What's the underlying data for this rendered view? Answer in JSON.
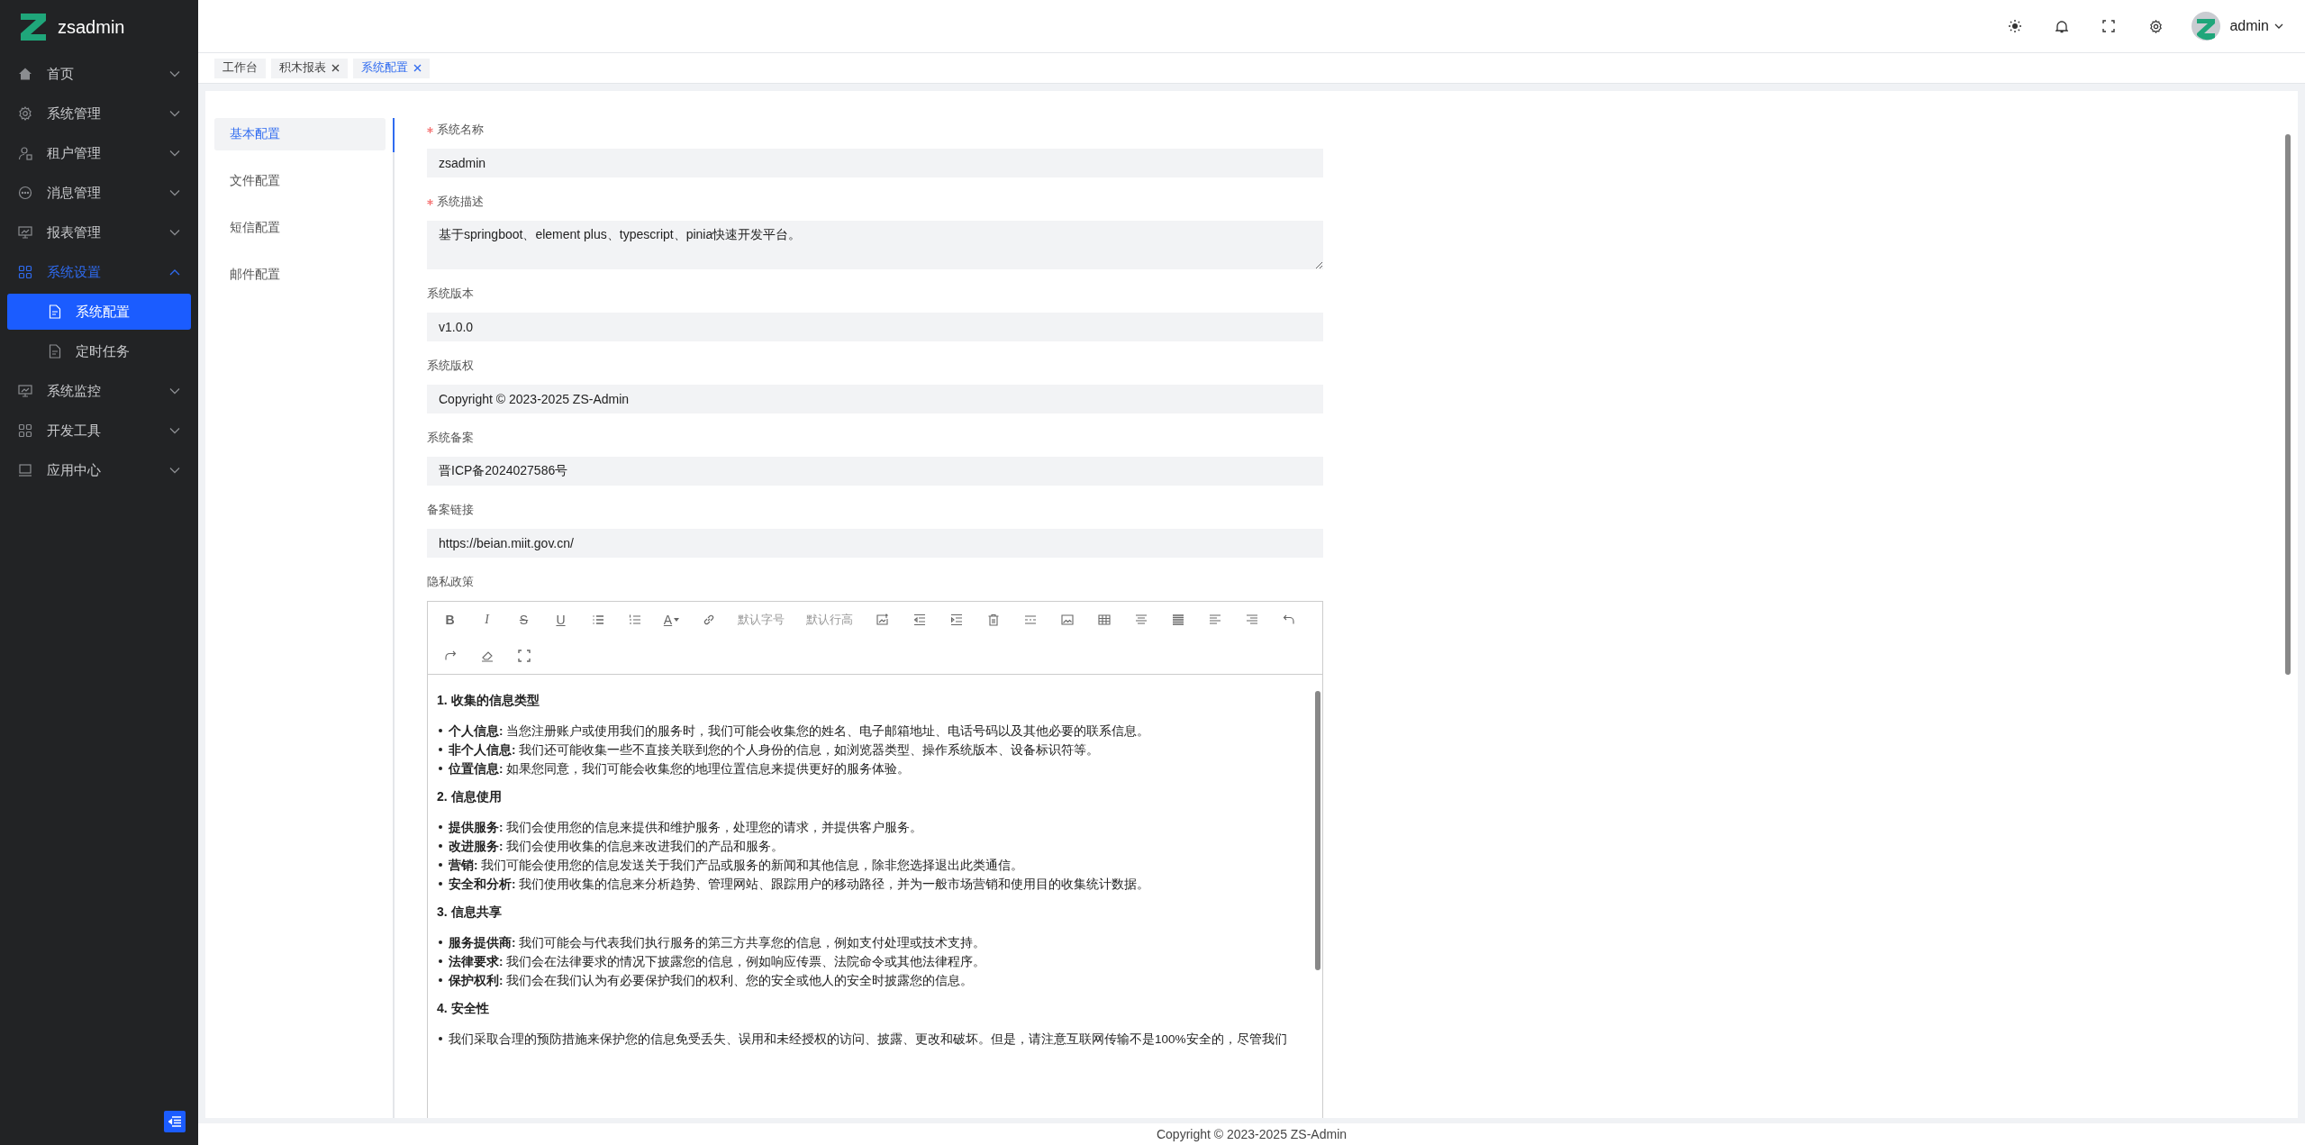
{
  "sidebar": {
    "logo": "zsadmin",
    "items": [
      {
        "kind": "home",
        "label": "首页",
        "expanded": false,
        "selected": false
      },
      {
        "kind": "gear",
        "label": "系统管理",
        "expanded": false,
        "selected": false
      },
      {
        "kind": "user",
        "label": "租户管理",
        "expanded": false,
        "selected": false
      },
      {
        "kind": "chat",
        "label": "消息管理",
        "expanded": false,
        "selected": false
      },
      {
        "kind": "board",
        "label": "报表管理",
        "expanded": false,
        "selected": false
      },
      {
        "kind": "grid",
        "label": "系统设置",
        "expanded": true,
        "selected": true,
        "children": [
          {
            "label": "系统配置",
            "selected": true
          },
          {
            "label": "定时任务",
            "selected": false
          }
        ]
      },
      {
        "kind": "board",
        "label": "系统监控",
        "expanded": false,
        "selected": false
      },
      {
        "kind": "grid",
        "label": "开发工具",
        "expanded": false,
        "selected": false
      },
      {
        "kind": "laptop",
        "label": "应用中心",
        "expanded": false,
        "selected": false
      }
    ]
  },
  "header": {
    "user": "admin"
  },
  "tabs": [
    {
      "label": "工作台",
      "closable": false,
      "selected": false
    },
    {
      "label": "积木报表",
      "closable": true,
      "selected": false
    },
    {
      "label": "系统配置",
      "closable": true,
      "selected": true
    }
  ],
  "config_tabs": [
    {
      "label": "基本配置",
      "selected": true
    },
    {
      "label": "文件配置",
      "selected": false
    },
    {
      "label": "短信配置",
      "selected": false
    },
    {
      "label": "邮件配置",
      "selected": false
    }
  ],
  "fields": [
    {
      "kind": "input",
      "label": "系统名称",
      "required": true,
      "value": "zsadmin"
    },
    {
      "kind": "textarea",
      "label": "系统描述",
      "required": true,
      "value": "基于springboot、element plus、typescript、pinia快速开发平台。"
    },
    {
      "kind": "input",
      "label": "系统版本",
      "required": false,
      "value": "v1.0.0"
    },
    {
      "kind": "input",
      "label": "系统版权",
      "required": false,
      "value": "Copyright © 2023-2025 ZS-Admin"
    },
    {
      "kind": "input",
      "label": "系统备案",
      "required": false,
      "value": "晋ICP备2024027586号"
    },
    {
      "kind": "input",
      "label": "备案链接",
      "required": false,
      "value": "https://beian.miit.gov.cn/"
    }
  ],
  "editor": {
    "label": "隐私政策",
    "toolbar": [
      {
        "kind": "bold",
        "label": "B"
      },
      {
        "kind": "italic",
        "label": "I"
      },
      {
        "kind": "strike",
        "label": "S"
      },
      {
        "kind": "underline",
        "label": "U"
      },
      {
        "kind": "bullets"
      },
      {
        "kind": "numbers"
      },
      {
        "kind": "color",
        "label": "A"
      },
      {
        "kind": "link"
      },
      {
        "kind": "select",
        "label": "默认字号"
      },
      {
        "kind": "select",
        "label": "默认行高"
      },
      {
        "kind": "image-upload"
      },
      {
        "kind": "outdent"
      },
      {
        "kind": "indent"
      },
      {
        "kind": "trash"
      },
      {
        "kind": "divider"
      },
      {
        "kind": "image"
      },
      {
        "kind": "table"
      },
      {
        "kind": "align-center"
      },
      {
        "kind": "align-justify"
      },
      {
        "kind": "align-left"
      },
      {
        "kind": "align-right"
      },
      {
        "kind": "undo"
      },
      {
        "kind": "redo"
      },
      {
        "kind": "eraser"
      },
      {
        "kind": "fullscreen"
      }
    ],
    "sections": [
      {
        "heading": "1. 收集的信息类型",
        "items": [
          "**个人信息:** 当您注册账户或使用我们的服务时，我们可能会收集您的姓名、电子邮箱地址、电话号码以及其他必要的联系信息。",
          "**非个人信息:** 我们还可能收集一些不直接关联到您的个人身份的信息，如浏览器类型、操作系统版本、设备标识符等。",
          "**位置信息:** 如果您同意，我们可能会收集您的地理位置信息来提供更好的服务体验。"
        ]
      },
      {
        "heading": "2. 信息使用",
        "items": [
          "**提供服务:** 我们会使用您的信息来提供和维护服务，处理您的请求，并提供客户服务。",
          "**改进服务:** 我们会使用收集的信息来改进我们的产品和服务。",
          "**营销:** 我们可能会使用您的信息发送关于我们产品或服务的新闻和其他信息，除非您选择退出此类通信。",
          "**安全和分析:** 我们使用收集的信息来分析趋势、管理网站、跟踪用户的移动路径，并为一般市场营销和使用目的收集统计数据。"
        ]
      },
      {
        "heading": "3. 信息共享",
        "items": [
          "**服务提供商:** 我们可能会与代表我们执行服务的第三方共享您的信息，例如支付处理或技术支持。",
          "**法律要求:** 我们会在法律要求的情况下披露您的信息，例如响应传票、法院命令或其他法律程序。",
          "**保护权利:** 我们会在我们认为有必要保护我们的权利、您的安全或他人的安全时披露您的信息。"
        ]
      },
      {
        "heading": "4. 安全性",
        "items": [
          "我们采取合理的预防措施来保护您的信息免受丢失、误用和未经授权的访问、披露、更改和破坏。但是，请注意互联网传输不是100%安全的，尽管我们"
        ]
      }
    ]
  },
  "footer": "Copyright © 2023-2025 ZS-Admin"
}
